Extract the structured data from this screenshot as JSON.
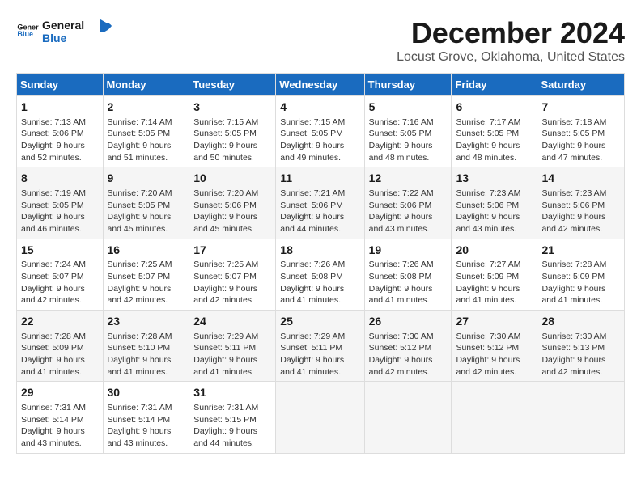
{
  "header": {
    "logo_line1": "General",
    "logo_line2": "Blue",
    "main_title": "December 2024",
    "subtitle": "Locust Grove, Oklahoma, United States"
  },
  "calendar": {
    "days_of_week": [
      "Sunday",
      "Monday",
      "Tuesday",
      "Wednesday",
      "Thursday",
      "Friday",
      "Saturday"
    ],
    "weeks": [
      [
        null,
        null,
        null,
        null,
        null,
        null,
        null
      ]
    ],
    "cells": [
      {
        "day": null,
        "row": 0,
        "col": 0
      },
      {
        "day": null,
        "row": 0,
        "col": 1
      },
      {
        "day": null,
        "row": 0,
        "col": 2
      },
      {
        "day": null,
        "row": 0,
        "col": 3
      },
      {
        "day": null,
        "row": 0,
        "col": 4
      },
      {
        "day": null,
        "row": 0,
        "col": 5
      },
      {
        "day": null,
        "row": 0,
        "col": 6
      }
    ]
  },
  "days": [
    {
      "num": "1",
      "sunrise": "Sunrise: 7:13 AM",
      "sunset": "Sunset: 5:06 PM",
      "daylight": "Daylight: 9 hours and 52 minutes."
    },
    {
      "num": "2",
      "sunrise": "Sunrise: 7:14 AM",
      "sunset": "Sunset: 5:05 PM",
      "daylight": "Daylight: 9 hours and 51 minutes."
    },
    {
      "num": "3",
      "sunrise": "Sunrise: 7:15 AM",
      "sunset": "Sunset: 5:05 PM",
      "daylight": "Daylight: 9 hours and 50 minutes."
    },
    {
      "num": "4",
      "sunrise": "Sunrise: 7:15 AM",
      "sunset": "Sunset: 5:05 PM",
      "daylight": "Daylight: 9 hours and 49 minutes."
    },
    {
      "num": "5",
      "sunrise": "Sunrise: 7:16 AM",
      "sunset": "Sunset: 5:05 PM",
      "daylight": "Daylight: 9 hours and 48 minutes."
    },
    {
      "num": "6",
      "sunrise": "Sunrise: 7:17 AM",
      "sunset": "Sunset: 5:05 PM",
      "daylight": "Daylight: 9 hours and 48 minutes."
    },
    {
      "num": "7",
      "sunrise": "Sunrise: 7:18 AM",
      "sunset": "Sunset: 5:05 PM",
      "daylight": "Daylight: 9 hours and 47 minutes."
    },
    {
      "num": "8",
      "sunrise": "Sunrise: 7:19 AM",
      "sunset": "Sunset: 5:05 PM",
      "daylight": "Daylight: 9 hours and 46 minutes."
    },
    {
      "num": "9",
      "sunrise": "Sunrise: 7:20 AM",
      "sunset": "Sunset: 5:05 PM",
      "daylight": "Daylight: 9 hours and 45 minutes."
    },
    {
      "num": "10",
      "sunrise": "Sunrise: 7:20 AM",
      "sunset": "Sunset: 5:06 PM",
      "daylight": "Daylight: 9 hours and 45 minutes."
    },
    {
      "num": "11",
      "sunrise": "Sunrise: 7:21 AM",
      "sunset": "Sunset: 5:06 PM",
      "daylight": "Daylight: 9 hours and 44 minutes."
    },
    {
      "num": "12",
      "sunrise": "Sunrise: 7:22 AM",
      "sunset": "Sunset: 5:06 PM",
      "daylight": "Daylight: 9 hours and 43 minutes."
    },
    {
      "num": "13",
      "sunrise": "Sunrise: 7:23 AM",
      "sunset": "Sunset: 5:06 PM",
      "daylight": "Daylight: 9 hours and 43 minutes."
    },
    {
      "num": "14",
      "sunrise": "Sunrise: 7:23 AM",
      "sunset": "Sunset: 5:06 PM",
      "daylight": "Daylight: 9 hours and 42 minutes."
    },
    {
      "num": "15",
      "sunrise": "Sunrise: 7:24 AM",
      "sunset": "Sunset: 5:07 PM",
      "daylight": "Daylight: 9 hours and 42 minutes."
    },
    {
      "num": "16",
      "sunrise": "Sunrise: 7:25 AM",
      "sunset": "Sunset: 5:07 PM",
      "daylight": "Daylight: 9 hours and 42 minutes."
    },
    {
      "num": "17",
      "sunrise": "Sunrise: 7:25 AM",
      "sunset": "Sunset: 5:07 PM",
      "daylight": "Daylight: 9 hours and 42 minutes."
    },
    {
      "num": "18",
      "sunrise": "Sunrise: 7:26 AM",
      "sunset": "Sunset: 5:08 PM",
      "daylight": "Daylight: 9 hours and 41 minutes."
    },
    {
      "num": "19",
      "sunrise": "Sunrise: 7:26 AM",
      "sunset": "Sunset: 5:08 PM",
      "daylight": "Daylight: 9 hours and 41 minutes."
    },
    {
      "num": "20",
      "sunrise": "Sunrise: 7:27 AM",
      "sunset": "Sunset: 5:09 PM",
      "daylight": "Daylight: 9 hours and 41 minutes."
    },
    {
      "num": "21",
      "sunrise": "Sunrise: 7:28 AM",
      "sunset": "Sunset: 5:09 PM",
      "daylight": "Daylight: 9 hours and 41 minutes."
    },
    {
      "num": "22",
      "sunrise": "Sunrise: 7:28 AM",
      "sunset": "Sunset: 5:09 PM",
      "daylight": "Daylight: 9 hours and 41 minutes."
    },
    {
      "num": "23",
      "sunrise": "Sunrise: 7:28 AM",
      "sunset": "Sunset: 5:10 PM",
      "daylight": "Daylight: 9 hours and 41 minutes."
    },
    {
      "num": "24",
      "sunrise": "Sunrise: 7:29 AM",
      "sunset": "Sunset: 5:11 PM",
      "daylight": "Daylight: 9 hours and 41 minutes."
    },
    {
      "num": "25",
      "sunrise": "Sunrise: 7:29 AM",
      "sunset": "Sunset: 5:11 PM",
      "daylight": "Daylight: 9 hours and 41 minutes."
    },
    {
      "num": "26",
      "sunrise": "Sunrise: 7:30 AM",
      "sunset": "Sunset: 5:12 PM",
      "daylight": "Daylight: 9 hours and 42 minutes."
    },
    {
      "num": "27",
      "sunrise": "Sunrise: 7:30 AM",
      "sunset": "Sunset: 5:12 PM",
      "daylight": "Daylight: 9 hours and 42 minutes."
    },
    {
      "num": "28",
      "sunrise": "Sunrise: 7:30 AM",
      "sunset": "Sunset: 5:13 PM",
      "daylight": "Daylight: 9 hours and 42 minutes."
    },
    {
      "num": "29",
      "sunrise": "Sunrise: 7:31 AM",
      "sunset": "Sunset: 5:14 PM",
      "daylight": "Daylight: 9 hours and 43 minutes."
    },
    {
      "num": "30",
      "sunrise": "Sunrise: 7:31 AM",
      "sunset": "Sunset: 5:14 PM",
      "daylight": "Daylight: 9 hours and 43 minutes."
    },
    {
      "num": "31",
      "sunrise": "Sunrise: 7:31 AM",
      "sunset": "Sunset: 5:15 PM",
      "daylight": "Daylight: 9 hours and 44 minutes."
    }
  ],
  "dow": [
    "Sunday",
    "Monday",
    "Tuesday",
    "Wednesday",
    "Thursday",
    "Friday",
    "Saturday"
  ]
}
